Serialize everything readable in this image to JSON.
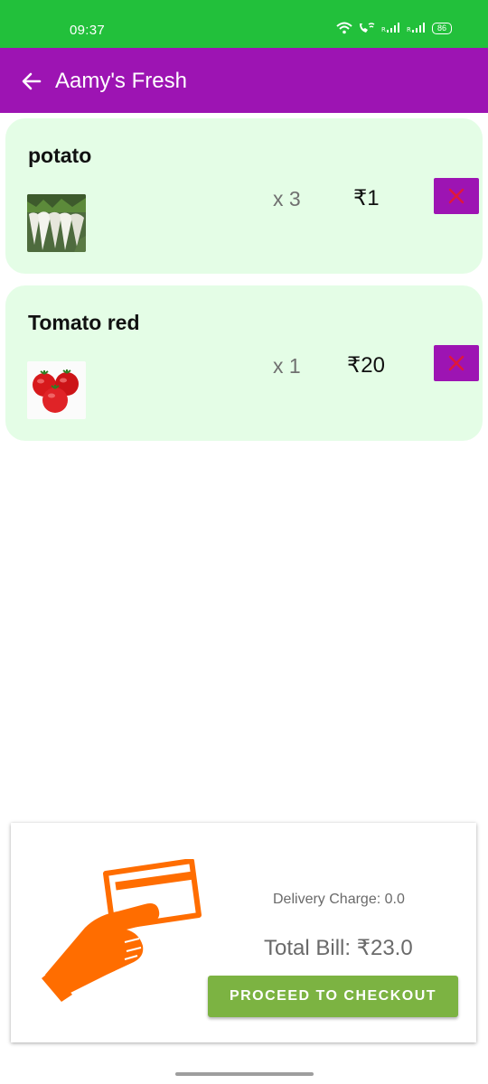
{
  "status_bar": {
    "time": "09:37",
    "battery_level": "86",
    "icons": [
      "wifi-icon",
      "wifi-calling-icon",
      "signal-icon",
      "signal-icon",
      "battery-icon"
    ]
  },
  "app_bar": {
    "title": "Aamy's Fresh",
    "back_icon": "arrow-left-icon"
  },
  "cart": {
    "items": [
      {
        "name": "potato",
        "quantity": "x 3",
        "price": "₹1",
        "image": "radish-bunch-photo",
        "remove_icon": "close-icon"
      },
      {
        "name": "Tomato red",
        "quantity": "x 1",
        "price": "₹20",
        "image": "tomatoes-photo",
        "remove_icon": "close-icon"
      }
    ]
  },
  "checkout": {
    "delivery_charge": "Delivery Charge: 0.0",
    "total_bill": "Total Bill: ₹23.0",
    "button_label": "PROCEED TO CHECKOUT",
    "illustration": "hand-holding-card-icon"
  },
  "colors": {
    "status_bar": "#22c03b",
    "app_bar": "#9d14b3",
    "item_card_bg": "#e4fde6",
    "remove_button_bg": "#9d14b3",
    "remove_icon": "#e0183a",
    "checkout_button": "#7cb342",
    "illustration": "#ff6d00"
  }
}
